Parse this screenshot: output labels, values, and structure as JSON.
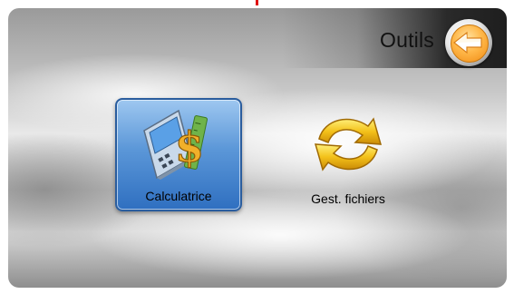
{
  "header": {
    "title": "Outils",
    "back_icon": "back-arrow-icon"
  },
  "tiles": [
    {
      "label": "Calculatrice",
      "icon": "calculator-icon",
      "selected": true
    },
    {
      "label": "Gest. fichiers",
      "icon": "file-sync-icon",
      "selected": false
    }
  ],
  "colors": {
    "accent_orange": "#f5a020",
    "selected_tile": "#4a86cf",
    "header_dark": "#222222"
  }
}
